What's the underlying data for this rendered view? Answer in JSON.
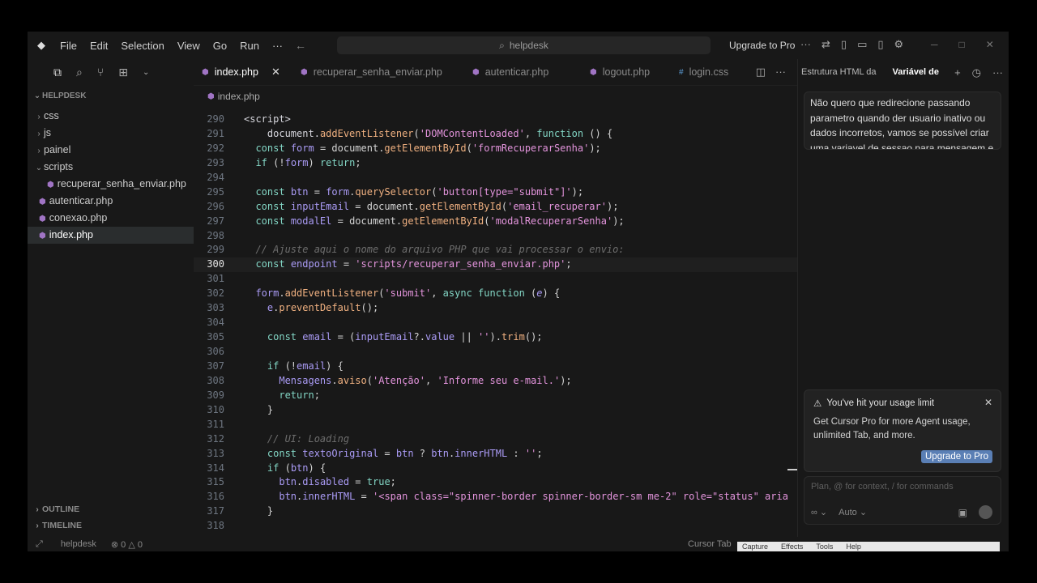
{
  "titlebar": {
    "menu": [
      "File",
      "Edit",
      "Selection",
      "View",
      "Go",
      "Run",
      "···"
    ],
    "search": "helpdesk",
    "upgrade": "Upgrade to Pro",
    "more": "···"
  },
  "sidebar": {
    "header": "HELPDESK",
    "items": [
      {
        "label": "css",
        "type": "folder",
        "depth": 1
      },
      {
        "label": "js",
        "type": "folder",
        "depth": 1
      },
      {
        "label": "painel",
        "type": "folder",
        "depth": 1
      },
      {
        "label": "scripts",
        "type": "folder-open",
        "depth": 1
      },
      {
        "label": "recuperar_senha_enviar.php",
        "type": "file",
        "depth": 2
      },
      {
        "label": "autenticar.php",
        "type": "file",
        "depth": 1
      },
      {
        "label": "conexao.php",
        "type": "file",
        "depth": 1
      },
      {
        "label": "index.php",
        "type": "file",
        "depth": 1,
        "selected": true
      }
    ],
    "outline": "OUTLINE",
    "timeline": "TIMELINE"
  },
  "editor": {
    "tabs": [
      {
        "label": "index.php",
        "icon": "php-icon",
        "active": true
      },
      {
        "label": "recuperar_senha_enviar.php",
        "icon": "php-icon"
      },
      {
        "label": "autenticar.php",
        "icon": "php-icon"
      },
      {
        "label": "logout.php",
        "icon": "php-icon"
      },
      {
        "label": "login.css",
        "icon": "css-icon"
      }
    ],
    "breadcrumb": "index.php",
    "current_line": 300,
    "lines": [
      {
        "n": 290,
        "html": "<span class='p'>&lt;script&gt;</span>",
        "indent": 0
      },
      {
        "n": 291,
        "html": "    <span class='p'>document.</span><span class='f'>addEventListener</span>(<span class='s'>'DOMContentLoaded'</span>, <span class='k'>function</span> () {",
        "indent": 0
      },
      {
        "n": 292,
        "html": "  <span class='k'>const</span> <span class='v'>form</span> = document.<span class='f'>getElementById</span>(<span class='s'>'formRecuperarSenha'</span>);",
        "indent": 0
      },
      {
        "n": 293,
        "html": "  <span class='k'>if</span> (!<span class='v'>form</span>) <span class='k'>return</span>;",
        "indent": 0
      },
      {
        "n": 294,
        "html": "",
        "indent": 0
      },
      {
        "n": 295,
        "html": "  <span class='k'>const</span> <span class='v'>btn</span> = <span class='v'>form</span>.<span class='f'>querySelector</span>(<span class='s'>'button[type=\"submit\"]'</span>);",
        "indent": 0
      },
      {
        "n": 296,
        "html": "  <span class='k'>const</span> <span class='v'>inputEmail</span> = document.<span class='f'>getElementById</span>(<span class='s'>'email_recuperar'</span>);",
        "indent": 0
      },
      {
        "n": 297,
        "html": "  <span class='k'>const</span> <span class='v'>modalEl</span> = document.<span class='f'>getElementById</span>(<span class='s'>'modalRecuperarSenha'</span>);",
        "indent": 0
      },
      {
        "n": 298,
        "html": "",
        "indent": 0
      },
      {
        "n": 299,
        "html": "  <span class='c'>// Ajuste aqui o nome do arquivo PHP que vai processar o envio:</span>",
        "indent": 0
      },
      {
        "n": 300,
        "html": "  <span class='k'>const</span> <span class='v'>endpoint</span> = <span class='s'>'scripts/recuperar_senha_enviar.php'</span>;",
        "indent": 0
      },
      {
        "n": 301,
        "html": "",
        "indent": 0
      },
      {
        "n": 302,
        "html": "  <span class='v'>form</span>.<span class='f'>addEventListener</span>(<span class='s'>'submit'</span>, <span class='k'>async function</span> (<span class='v'><i>e</i></span>) {",
        "indent": 0
      },
      {
        "n": 303,
        "html": "    <span class='v'>e</span>.<span class='f'>preventDefault</span>();",
        "indent": 0
      },
      {
        "n": 304,
        "html": "",
        "indent": 0
      },
      {
        "n": 305,
        "html": "    <span class='k'>const</span> <span class='v'>email</span> = (<span class='v'>inputEmail</span>?.<span class='v'>value</span> || <span class='s'>''</span>).<span class='f'>trim</span>();",
        "indent": 0
      },
      {
        "n": 306,
        "html": "",
        "indent": 0
      },
      {
        "n": 307,
        "html": "    <span class='k'>if</span> (!<span class='v'>email</span>) {",
        "indent": 0
      },
      {
        "n": 308,
        "html": "      <span class='v'>Mensagens</span>.<span class='f'>aviso</span>(<span class='s'>'Atenção'</span>, <span class='s'>'Informe seu e-mail.'</span>);",
        "indent": 0
      },
      {
        "n": 309,
        "html": "      <span class='k'>return</span>;",
        "indent": 0
      },
      {
        "n": 310,
        "html": "    }",
        "indent": 0
      },
      {
        "n": 311,
        "html": "",
        "indent": 0
      },
      {
        "n": 312,
        "html": "    <span class='c'>// UI: Loading</span>",
        "indent": 0
      },
      {
        "n": 313,
        "html": "    <span class='k'>const</span> <span class='v'>textoOriginal</span> = <span class='v'>btn</span> ? <span class='v'>btn</span>.<span class='v'>innerHTML</span> : <span class='s'>''</span>;",
        "indent": 0
      },
      {
        "n": 314,
        "html": "    <span class='k'>if</span> (<span class='v'>btn</span>) {",
        "indent": 0
      },
      {
        "n": 315,
        "html": "      <span class='v'>btn</span>.<span class='v'>disabled</span> = <span class='k'>true</span>;",
        "indent": 0
      },
      {
        "n": 316,
        "html": "      <span class='v'>btn</span>.<span class='v'>innerHTML</span> = <span class='s'>'&lt;span class=\"spinner-border spinner-border-sm me-2\" role=\"status\" aria</span>",
        "indent": 0
      },
      {
        "n": 317,
        "html": "    }",
        "indent": 0
      },
      {
        "n": 318,
        "html": "",
        "indent": 0
      }
    ]
  },
  "chat": {
    "tabs": [
      "Estrutura HTML da",
      "Variável de"
    ],
    "active_tab": "Variável de",
    "message": "Não quero que redirecione passando parametro quando der usuario inativo ou dados incorretos, vamos se possível criar uma variavel de sessao para mensagem e",
    "limit_title": "You've hit your usage limit",
    "limit_body": "Get Cursor Pro for more Agent usage, unlimited Tab, and more.",
    "limit_button": "Upgrade to Pro",
    "input_placeholder": "Plan, @ for context, / for commands",
    "mode": "∞",
    "model": "Auto"
  },
  "status": {
    "workspace": "helpdesk",
    "errors": "0",
    "warnings": "0",
    "cursor_tab": "Cursor Tab"
  },
  "capture_bar": [
    "Capture",
    "Effects",
    "Tools",
    "Help"
  ]
}
